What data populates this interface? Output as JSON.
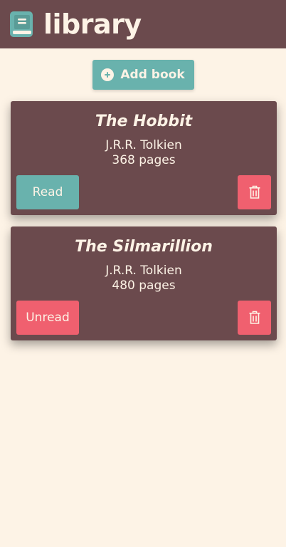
{
  "header": {
    "title": "library",
    "logo_icon": "book-icon"
  },
  "toolbar": {
    "add_label": "Add book",
    "add_icon": "plus-circle-icon"
  },
  "books": [
    {
      "title": "The Hobbit",
      "author": "J.R.R. Tolkien",
      "pages": "368 pages",
      "status": "Read",
      "status_color": "#69b2ad"
    },
    {
      "title": "The Silmarillion",
      "author": "J.R.R. Tolkien",
      "pages": "480 pages",
      "status": "Unread",
      "status_color": "#f0606f"
    }
  ],
  "colors": {
    "header_bg": "#6b4a4d",
    "page_bg": "#fdf3e6",
    "accent": "#69b2ad",
    "danger": "#f0606f"
  }
}
